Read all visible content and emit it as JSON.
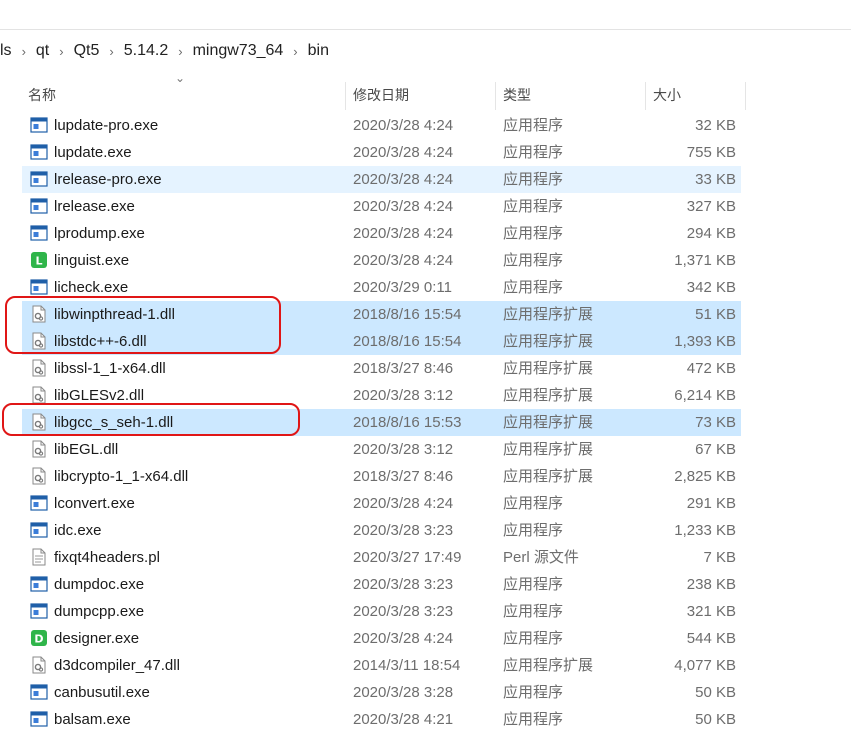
{
  "breadcrumb": [
    "ls",
    "qt",
    "Qt5",
    "5.14.2",
    "mingw73_64",
    "bin"
  ],
  "columns": {
    "name": "名称",
    "date": "修改日期",
    "type": "类型",
    "size": "大小"
  },
  "files": [
    {
      "name": "lupdate-pro.exe",
      "date": "2020/3/28 4:24",
      "type": "应用程序",
      "size": "32 KB",
      "icon": "app-window-icon",
      "state": ""
    },
    {
      "name": "lupdate.exe",
      "date": "2020/3/28 4:24",
      "type": "应用程序",
      "size": "755 KB",
      "icon": "app-window-icon",
      "state": ""
    },
    {
      "name": "lrelease-pro.exe",
      "date": "2020/3/28 4:24",
      "type": "应用程序",
      "size": "33 KB",
      "icon": "app-window-icon",
      "state": "hover"
    },
    {
      "name": "lrelease.exe",
      "date": "2020/3/28 4:24",
      "type": "应用程序",
      "size": "327 KB",
      "icon": "app-window-icon",
      "state": ""
    },
    {
      "name": "lprodump.exe",
      "date": "2020/3/28 4:24",
      "type": "应用程序",
      "size": "294 KB",
      "icon": "app-window-icon",
      "state": ""
    },
    {
      "name": "linguist.exe",
      "date": "2020/3/28 4:24",
      "type": "应用程序",
      "size": "1,371 KB",
      "icon": "linguist-app-icon",
      "state": ""
    },
    {
      "name": "licheck.exe",
      "date": "2020/3/29 0:11",
      "type": "应用程序",
      "size": "342 KB",
      "icon": "app-window-icon",
      "state": ""
    },
    {
      "name": "libwinpthread-1.dll",
      "date": "2018/8/16 15:54",
      "type": "应用程序扩展",
      "size": "51 KB",
      "icon": "dll-gear-icon",
      "state": "sel"
    },
    {
      "name": "libstdc++-6.dll",
      "date": "2018/8/16 15:54",
      "type": "应用程序扩展",
      "size": "1,393 KB",
      "icon": "dll-gear-icon",
      "state": "sel"
    },
    {
      "name": "libssl-1_1-x64.dll",
      "date": "2018/3/27 8:46",
      "type": "应用程序扩展",
      "size": "472 KB",
      "icon": "dll-gear-icon",
      "state": ""
    },
    {
      "name": "libGLESv2.dll",
      "date": "2020/3/28 3:12",
      "type": "应用程序扩展",
      "size": "6,214 KB",
      "icon": "dll-gear-icon",
      "state": ""
    },
    {
      "name": "libgcc_s_seh-1.dll",
      "date": "2018/8/16 15:53",
      "type": "应用程序扩展",
      "size": "73 KB",
      "icon": "dll-gear-icon",
      "state": "sel"
    },
    {
      "name": "libEGL.dll",
      "date": "2020/3/28 3:12",
      "type": "应用程序扩展",
      "size": "67 KB",
      "icon": "dll-gear-icon",
      "state": ""
    },
    {
      "name": "libcrypto-1_1-x64.dll",
      "date": "2018/3/27 8:46",
      "type": "应用程序扩展",
      "size": "2,825 KB",
      "icon": "dll-gear-icon",
      "state": ""
    },
    {
      "name": "lconvert.exe",
      "date": "2020/3/28 4:24",
      "type": "应用程序",
      "size": "291 KB",
      "icon": "app-window-icon",
      "state": ""
    },
    {
      "name": "idc.exe",
      "date": "2020/3/28 3:23",
      "type": "应用程序",
      "size": "1,233 KB",
      "icon": "app-window-icon",
      "state": ""
    },
    {
      "name": "fixqt4headers.pl",
      "date": "2020/3/27 17:49",
      "type": "Perl 源文件",
      "size": "7 KB",
      "icon": "text-file-icon",
      "state": ""
    },
    {
      "name": "dumpdoc.exe",
      "date": "2020/3/28 3:23",
      "type": "应用程序",
      "size": "238 KB",
      "icon": "app-window-icon",
      "state": ""
    },
    {
      "name": "dumpcpp.exe",
      "date": "2020/3/28 3:23",
      "type": "应用程序",
      "size": "321 KB",
      "icon": "app-window-icon",
      "state": ""
    },
    {
      "name": "designer.exe",
      "date": "2020/3/28 4:24",
      "type": "应用程序",
      "size": "544 KB",
      "icon": "designer-app-icon",
      "state": ""
    },
    {
      "name": "d3dcompiler_47.dll",
      "date": "2014/3/11 18:54",
      "type": "应用程序扩展",
      "size": "4,077 KB",
      "icon": "dll-gear-icon",
      "state": ""
    },
    {
      "name": "canbusutil.exe",
      "date": "2020/3/28 3:28",
      "type": "应用程序",
      "size": "50 KB",
      "icon": "app-window-icon",
      "state": ""
    },
    {
      "name": "balsam.exe",
      "date": "2020/3/28 4:21",
      "type": "应用程序",
      "size": "50 KB",
      "icon": "app-window-icon",
      "state": ""
    }
  ],
  "colors": {
    "selected": "#cce8ff",
    "hover": "#e5f3ff",
    "annotation": "#e01616",
    "app_icon_blue": "#1f5fa8",
    "qt_green": "#2fb54a"
  }
}
